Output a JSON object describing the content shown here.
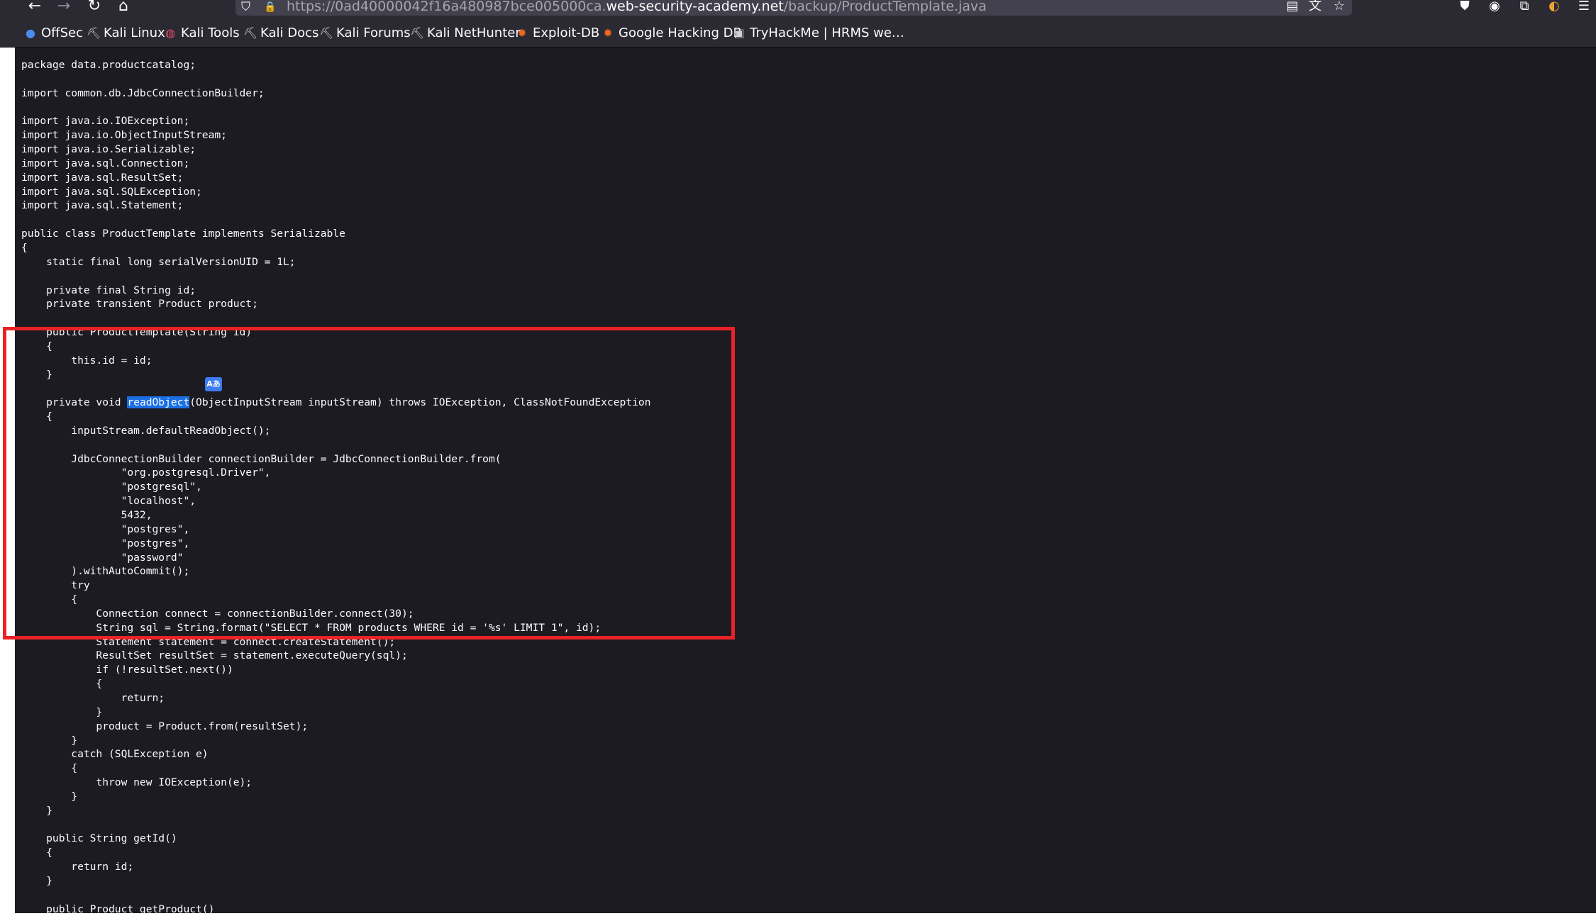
{
  "toolbar": {
    "back_icon": "←",
    "forward_icon": "→",
    "reload_icon": "↻",
    "home_icon": "⌂",
    "shield_icon": "⛉",
    "lock_icon": "🔒",
    "url_prefix": "https://0ad40000042f16a480987bce005000ca.",
    "url_host": "web-security-academy.net",
    "url_path": "/backup/ProductTemplate.java",
    "reader_icon": "▤",
    "translate_icon": "文",
    "star_icon": "☆",
    "pocket_icon": "⛊",
    "account_icon": "◉",
    "extensions_icon": "⧉",
    "fox_icon": "◐",
    "menu_icon": "☰"
  },
  "bookmarks": [
    {
      "label": "OffSec",
      "icon": "●",
      "color": "#4a8cf0"
    },
    {
      "label": "Kali Linux",
      "icon": "⛏",
      "color": "#cfcfd8"
    },
    {
      "label": "Kali Tools",
      "icon": "◍",
      "color": "#e04b6a"
    },
    {
      "label": "Kali Docs",
      "icon": "⛏",
      "color": "#cfcfd8"
    },
    {
      "label": "Kali Forums",
      "icon": "⛏",
      "color": "#cfcfd8"
    },
    {
      "label": "Kali NetHunter",
      "icon": "⛏",
      "color": "#cfcfd8"
    },
    {
      "label": "Exploit-DB",
      "icon": "✹",
      "color": "#f06a1e"
    },
    {
      "label": "Google Hacking DB",
      "icon": "✹",
      "color": "#f06a1e"
    },
    {
      "label": "TryHackMe | HRMS we…",
      "icon": "▣",
      "color": "#d0d0d8"
    }
  ],
  "code": {
    "before": "package data.productcatalog;\n\nimport common.db.JdbcConnectionBuilder;\n\nimport java.io.IOException;\nimport java.io.ObjectInputStream;\nimport java.io.Serializable;\nimport java.sql.Connection;\nimport java.sql.ResultSet;\nimport java.sql.SQLException;\nimport java.sql.Statement;\n\npublic class ProductTemplate implements Serializable\n{\n    static final long serialVersionUID = 1L;\n\n    private final String id;\n    private transient Product product;\n\n    public ProductTemplate(String id)\n    {\n        this.id = id;\n    }\n\n    private void ",
    "selected": "readObject",
    "after": "(ObjectInputStream inputStream) throws IOException, ClassNotFoundException\n    {\n        inputStream.defaultReadObject();\n\n        JdbcConnectionBuilder connectionBuilder = JdbcConnectionBuilder.from(\n                \"org.postgresql.Driver\",\n                \"postgresql\",\n                \"localhost\",\n                5432,\n                \"postgres\",\n                \"postgres\",\n                \"password\"\n        ).withAutoCommit();\n        try\n        {\n            Connection connect = connectionBuilder.connect(30);\n            String sql = String.format(\"SELECT * FROM products WHERE id = '%s' LIMIT 1\", id);\n            Statement statement = connect.createStatement();\n            ResultSet resultSet = statement.executeQuery(sql);\n            if (!resultSet.next())\n            {\n                return;\n            }\n            product = Product.from(resultSet);\n        }\n        catch (SQLException e)\n        {\n            throw new IOException(e);\n        }\n    }\n\n    public String getId()\n    {\n        return id;\n    }\n\n    public Product getProduct()"
  },
  "translate_popup": {
    "icon": "Aあ"
  },
  "colors": {
    "highlight_box": "#ea2226",
    "selection": "#1a6fe6"
  }
}
